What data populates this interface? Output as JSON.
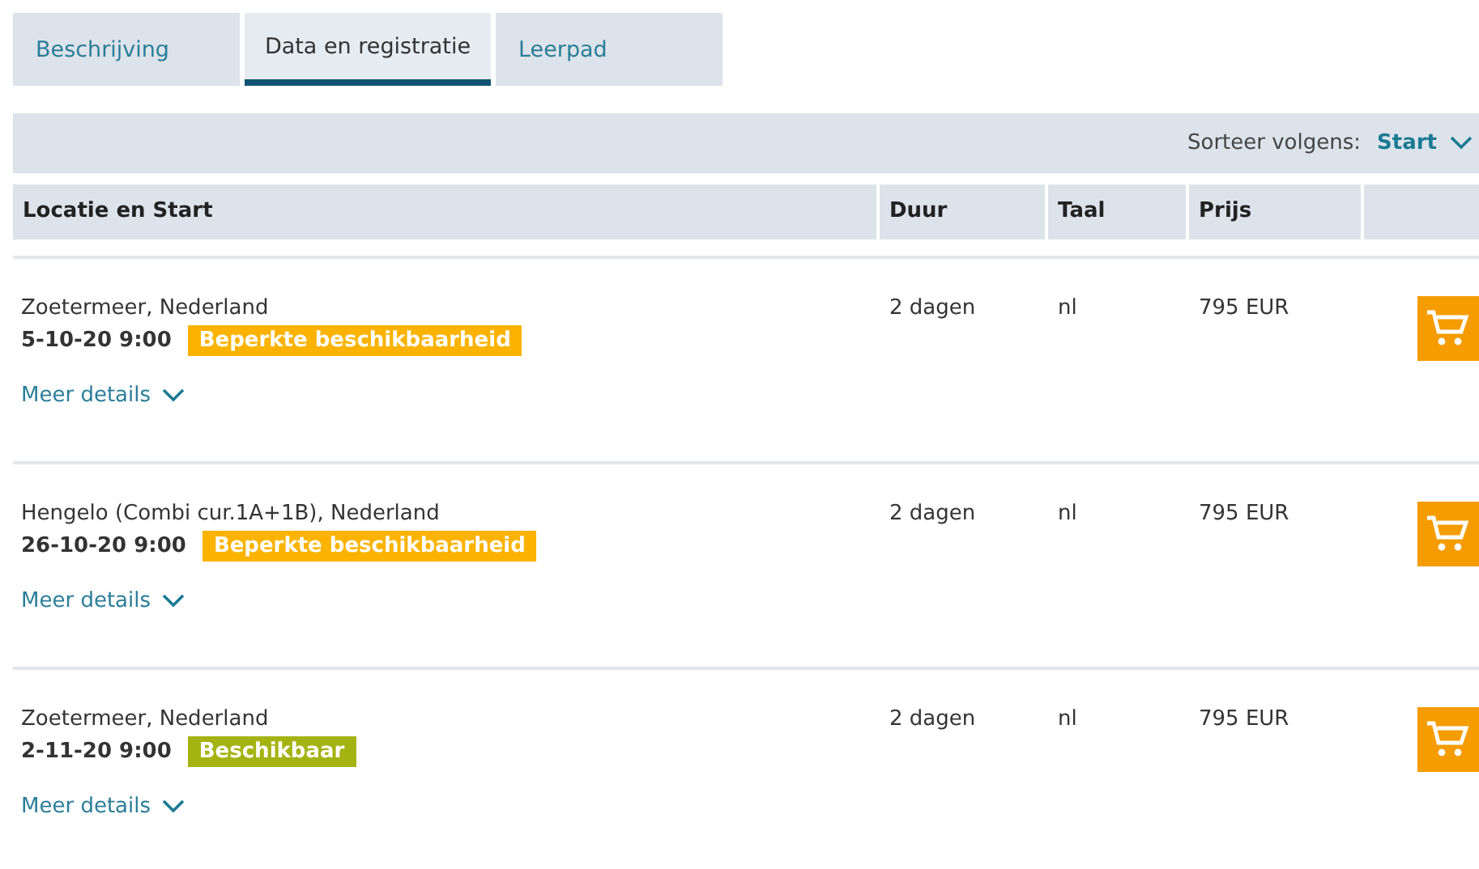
{
  "tabs": [
    {
      "label": "Beschrijving",
      "selected": false
    },
    {
      "label": "Data en registratie",
      "selected": true
    },
    {
      "label": "Leerpad",
      "selected": false
    }
  ],
  "sort": {
    "label": "Sorteer volgens:",
    "value": "Start"
  },
  "table": {
    "columns": [
      "Locatie en Start",
      "Duur",
      "Taal",
      "Prijs"
    ],
    "rows": [
      {
        "location": "Zoetermeer, Nederland",
        "start": "5-10-20 9:00",
        "status": "Beperkte beschikbaarheid",
        "color": "#fbb300",
        "duration": "2 dagen",
        "language": "nl",
        "price": "795 EUR",
        "details": "Meer details"
      },
      {
        "location": "Hengelo (Combi cur.1A+1B), Nederland",
        "start": "26-10-20 9:00",
        "status": "Beperkte beschikbaarheid",
        "color": "#fbb300",
        "duration": "2 dagen",
        "language": "nl",
        "price": "795 EUR",
        "details": "Meer details"
      },
      {
        "location": "Zoetermeer, Nederland",
        "start": "2-11-20 9:00",
        "status": "Beschikbaar",
        "color": "#a5b312",
        "duration": "2 dagen",
        "language": "nl",
        "price": "795 EUR",
        "details": "Meer details"
      }
    ]
  }
}
